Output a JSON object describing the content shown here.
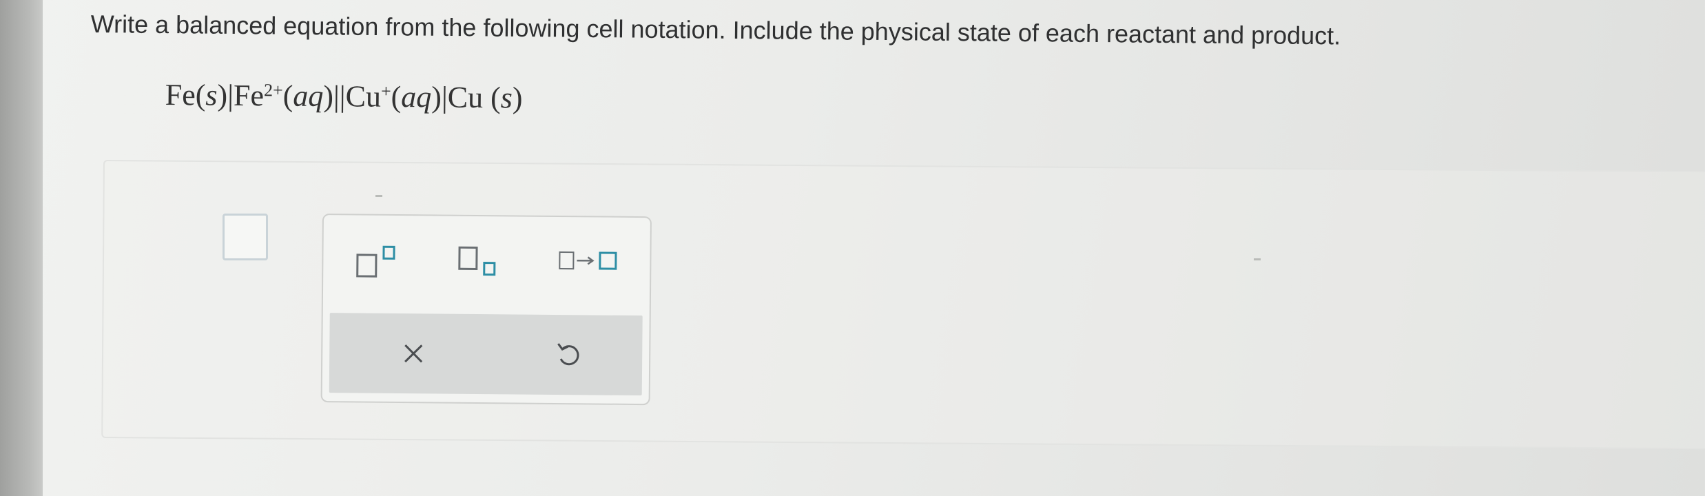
{
  "question": {
    "prompt": "Write a balanced equation from the following cell notation. Include the physical state of each reactant and product."
  },
  "cell_notation": {
    "anode_metal": "Fe",
    "anode_metal_state": "s",
    "anode_ion": "Fe",
    "anode_ion_charge": "2+",
    "anode_ion_state": "aq",
    "cathode_ion": "Cu",
    "cathode_ion_charge": "+",
    "cathode_ion_state": "aq",
    "cathode_metal": "Cu",
    "cathode_metal_state": "s"
  },
  "answer": {
    "value": ""
  },
  "toolbox": {
    "tools": [
      "superscript",
      "subscript",
      "reaction-arrow"
    ],
    "actions": [
      "clear",
      "undo"
    ]
  },
  "colors": {
    "text": "#2f3031",
    "tool_accent": "#2d8ea5",
    "tool_box_gray": "#6a6f73",
    "action_bar": "#d7d9d8"
  }
}
